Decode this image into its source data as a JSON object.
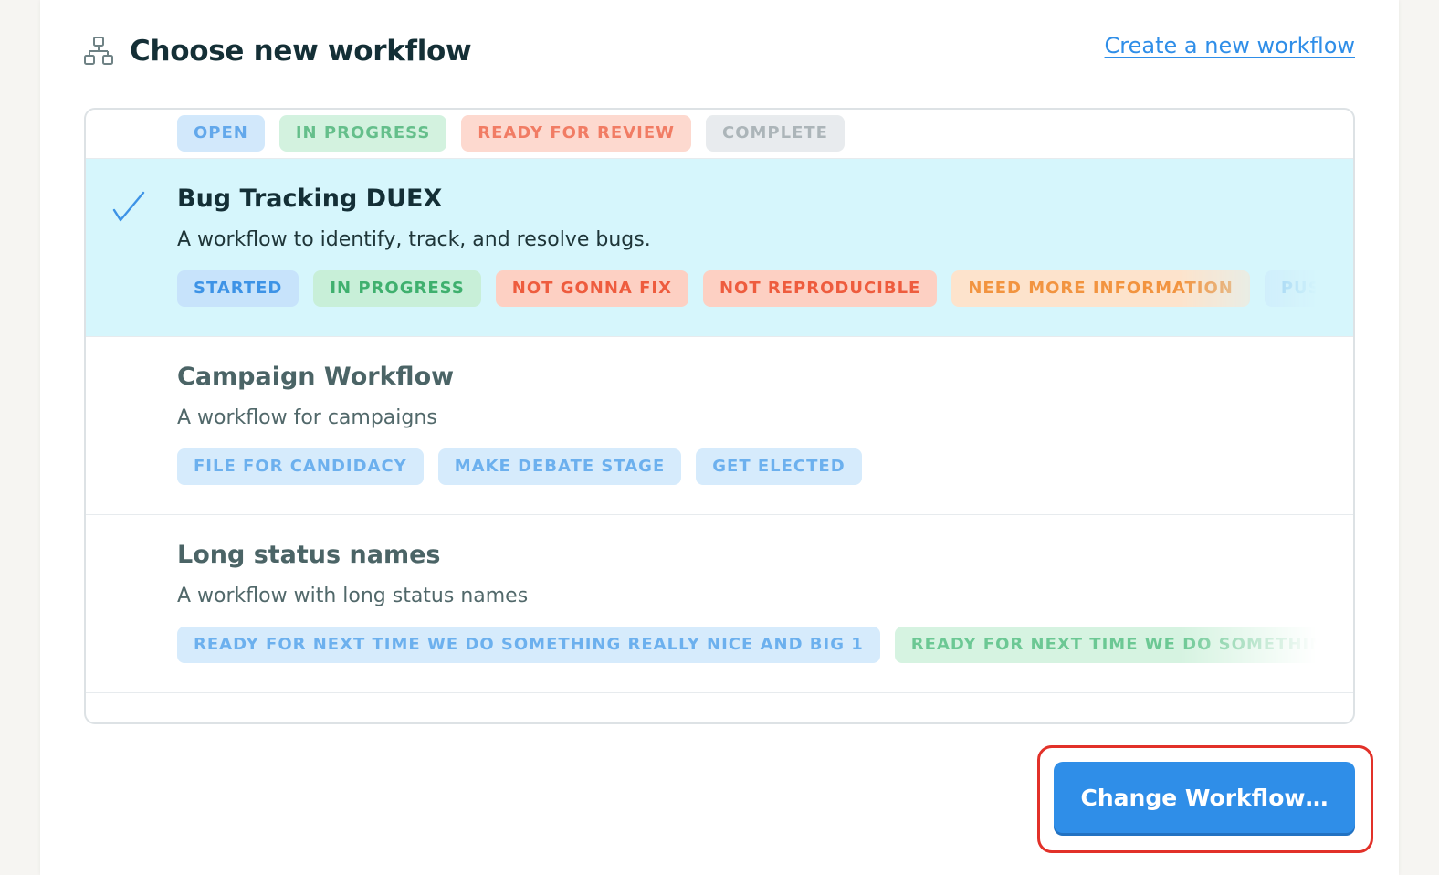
{
  "header": {
    "icon": "workflow-hierarchy-icon",
    "title": "Choose new workflow",
    "create_link": "Create a new workflow"
  },
  "partial_row": {
    "statuses": [
      {
        "label": "OPEN",
        "color": "blue"
      },
      {
        "label": "IN PROGRESS",
        "color": "green"
      },
      {
        "label": "READY FOR REVIEW",
        "color": "red"
      },
      {
        "label": "COMPLETE",
        "color": "gray"
      }
    ]
  },
  "workflows": [
    {
      "title": "Bug Tracking DUEX",
      "description": "A workflow to identify, track, and resolve bugs.",
      "selected": true,
      "statuses": [
        {
          "label": "STARTED",
          "color": "blue"
        },
        {
          "label": "IN PROGRESS",
          "color": "green"
        },
        {
          "label": "NOT GONNA FIX",
          "color": "red"
        },
        {
          "label": "NOT REPRODUCIBLE",
          "color": "red"
        },
        {
          "label": "NEED MORE INFORMATION",
          "color": "orange"
        },
        {
          "label": "PUSHED B",
          "color": "blue"
        }
      ]
    },
    {
      "title": "Campaign Workflow",
      "description": "A workflow for campaigns",
      "selected": false,
      "statuses": [
        {
          "label": "FILE FOR CANDIDACY",
          "color": "blue"
        },
        {
          "label": "MAKE DEBATE STAGE",
          "color": "blue"
        },
        {
          "label": "GET ELECTED",
          "color": "blue"
        }
      ]
    },
    {
      "title": "Long status names",
      "description": "A workflow with long status names",
      "selected": false,
      "statuses": [
        {
          "label": "READY FOR NEXT TIME WE DO SOMETHING REALLY NICE AND BIG 1",
          "color": "blue"
        },
        {
          "label": "READY FOR NEXT TIME WE DO SOMETHING REALL",
          "color": "green"
        }
      ]
    }
  ],
  "change_button": {
    "label": "Change Workflow…"
  },
  "colors": {
    "accent": "#2f8ee8",
    "selected_row": "#d6f6fc",
    "highlight_ring": "#e23129"
  }
}
